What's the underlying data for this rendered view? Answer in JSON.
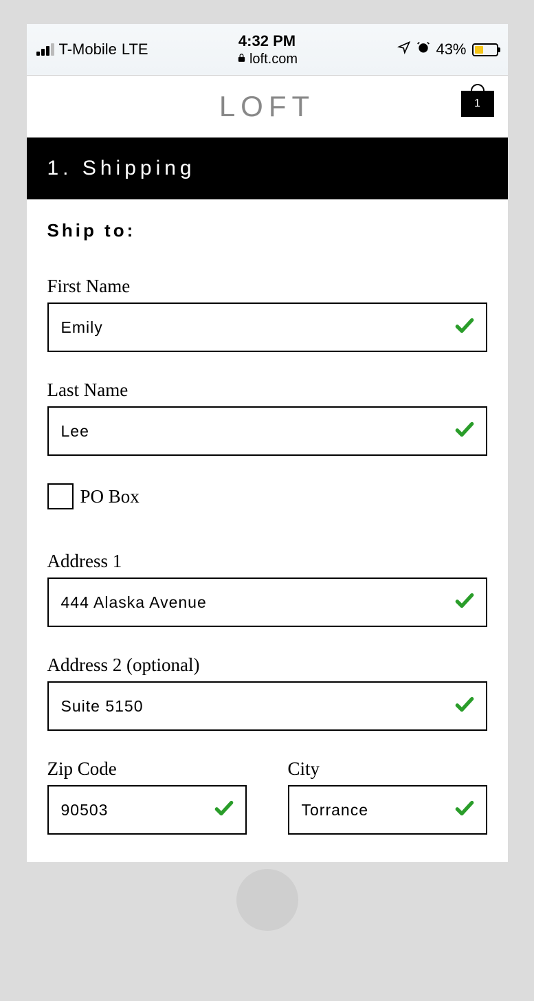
{
  "status_bar": {
    "carrier": "T-Mobile",
    "network": "LTE",
    "time": "4:32 PM",
    "url": "loft.com",
    "battery_percent": "43%"
  },
  "header": {
    "logo_text": "LOFT",
    "cart_count": "1"
  },
  "section": {
    "title": "1. Shipping",
    "ship_to_label": "Ship to:"
  },
  "form": {
    "first_name": {
      "label": "First Name",
      "value": "Emily",
      "valid": true
    },
    "last_name": {
      "label": "Last Name",
      "value": "Lee",
      "valid": true
    },
    "po_box": {
      "label": "PO Box",
      "checked": false
    },
    "address1": {
      "label": "Address 1",
      "value": "444 Alaska Avenue",
      "valid": true
    },
    "address2": {
      "label": "Address 2 (optional)",
      "value": "Suite 5150",
      "valid": true
    },
    "zip": {
      "label": "Zip Code",
      "value": "90503",
      "valid": true
    },
    "city": {
      "label": "City",
      "value": "Torrance",
      "valid": true
    }
  }
}
